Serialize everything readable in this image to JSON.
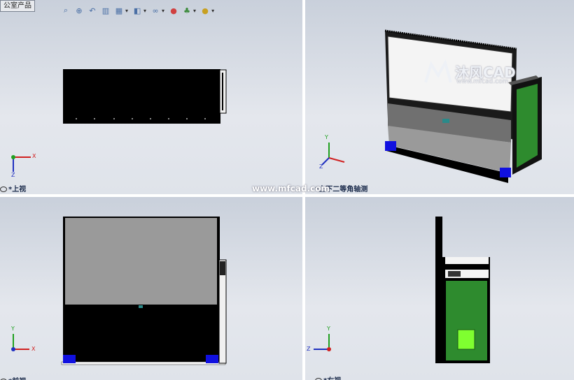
{
  "doc_tab": "公室产品",
  "toolbar": {
    "icons": [
      "zoom-fit-icon",
      "zoom-area-icon",
      "previous-view-icon",
      "section-view-icon",
      "view-orientation-icon",
      "display-style-icon",
      "hide-show-icon",
      "appearance-icon",
      "scene-icon",
      "render-icon"
    ]
  },
  "views": {
    "top": "上视",
    "iso": "上下二等角轴测",
    "front": "前视",
    "right": "右视"
  },
  "axes": {
    "x": "X",
    "y": "Y",
    "z": "Z"
  },
  "watermark": {
    "brand": "沐风CAD",
    "url_small": "www.mfcad.com",
    "url_center": "www.mfcad.com"
  },
  "colors": {
    "background": "#dfe3ea",
    "model_body": "#000000",
    "screen": "#9a9a9a",
    "foot": "#1010e0",
    "pcb": "#2e8b2e"
  }
}
